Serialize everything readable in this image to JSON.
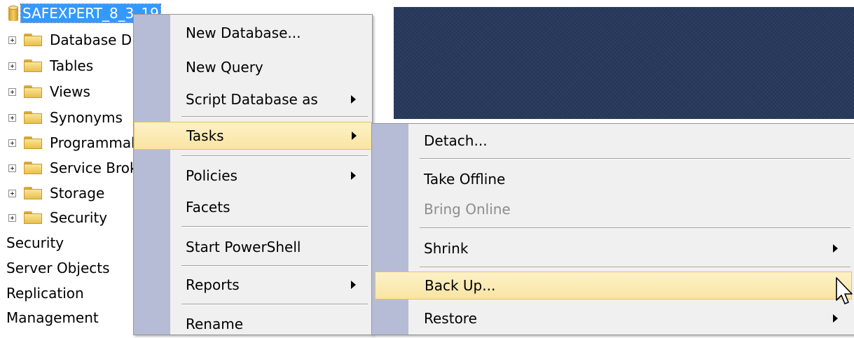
{
  "tree": {
    "database_name": "SAFEXPERT_8_3_19",
    "folders": [
      {
        "label": "Database Diagrams"
      },
      {
        "label": "Tables"
      },
      {
        "label": "Views"
      },
      {
        "label": "Synonyms"
      },
      {
        "label": "Programmability"
      },
      {
        "label": "Service Broker"
      },
      {
        "label": "Storage"
      },
      {
        "label": "Security"
      }
    ],
    "root_items": [
      {
        "label": "Security"
      },
      {
        "label": "Server Objects"
      },
      {
        "label": "Replication"
      },
      {
        "label": "Management"
      }
    ]
  },
  "context_menu": {
    "items": [
      {
        "label": "New Database..."
      },
      {
        "label": "New Query"
      },
      {
        "label": "Script Database as"
      },
      {
        "label": "Tasks"
      },
      {
        "label": "Policies"
      },
      {
        "label": "Facets"
      },
      {
        "label": "Start PowerShell"
      },
      {
        "label": "Reports"
      },
      {
        "label": "Rename"
      }
    ]
  },
  "tasks_menu": {
    "items": [
      {
        "label": "Detach..."
      },
      {
        "label": "Take Offline"
      },
      {
        "label": "Bring Online"
      },
      {
        "label": "Shrink"
      },
      {
        "label": "Back Up..."
      },
      {
        "label": "Restore"
      }
    ]
  },
  "colors": {
    "selection": "#3399ff",
    "menu_highlight": "#f9e4a1",
    "menu_gutter": "#b6bcd6",
    "dark_pane": "#283a5c"
  }
}
